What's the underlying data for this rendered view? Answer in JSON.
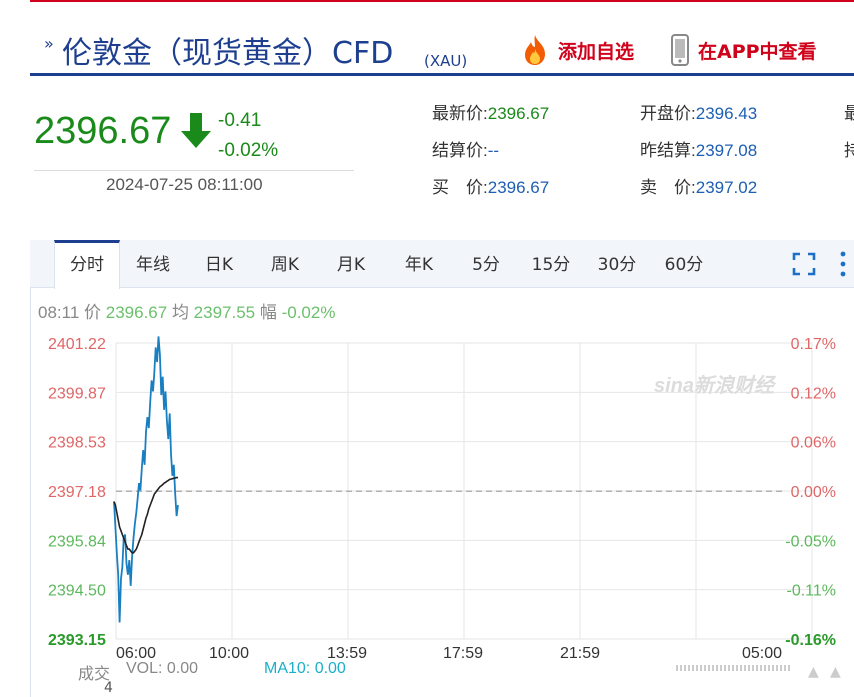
{
  "header": {
    "title": "伦敦金（现货黄金）CFD",
    "code": "(XAU)",
    "add_fav": "添加自选",
    "app_view": "在APP中查看",
    "chevron_glyph": "»"
  },
  "quote": {
    "price": "2396.67",
    "change": "-0.41",
    "change_pct": "-0.02%",
    "datetime": "2024-07-25 08:11:00",
    "direction": "down",
    "color_down": "#1a8a1a"
  },
  "stats": [
    {
      "label": "最新价:",
      "value": "2396.67",
      "green": true
    },
    {
      "label": "开盘价:",
      "value": "2396.43",
      "green": false
    },
    {
      "label": "结算价:",
      "value": "--",
      "green": false
    },
    {
      "label": "昨结算:",
      "value": "2397.08",
      "green": false
    },
    {
      "label": "买　价:",
      "value": "2396.67",
      "green": false
    },
    {
      "label": "卖　价:",
      "value": "2397.02",
      "green": false
    }
  ],
  "stats_cut": [
    "最",
    "持"
  ],
  "tabs": [
    "分时",
    "年线",
    "日K",
    "周K",
    "月K",
    "年K",
    "5分",
    "15分",
    "30分",
    "60分"
  ],
  "active_tab": "分时",
  "info": {
    "time": "08:11",
    "price_label": "价",
    "price": "2396.67",
    "avg_label": "均",
    "avg": "2397.55",
    "range_label": "幅",
    "range": "-0.02%"
  },
  "watermark": "sina新浪财经",
  "volume": {
    "label": "成交",
    "vol": "VOL: 0.00",
    "ma10": "MA10: 0.00",
    "count": "4"
  },
  "chart_data": {
    "type": "line",
    "title": "",
    "y_left_ticks": [
      "2401.22",
      "2399.87",
      "2398.53",
      "2397.18",
      "2395.84",
      "2394.50",
      "2393.15"
    ],
    "y_right_ticks": [
      "0.17%",
      "0.12%",
      "0.06%",
      "0.00%",
      "-0.05%",
      "-0.11%",
      "-0.16%"
    ],
    "x_ticks": [
      "06:00",
      "10:00",
      "13:59",
      "17:59",
      "21:59",
      "05:00"
    ],
    "ylim": [
      2393.15,
      2401.22
    ],
    "reference_price": 2397.18,
    "colors": {
      "price": "#1a7fc1",
      "avg": "#222222",
      "up": "#e06666",
      "down": "#5cb85c",
      "grid": "#e6e6e6"
    },
    "series": [
      {
        "name": "价",
        "values": [
          2396.9,
          2396.2,
          2395.5,
          2394.9,
          2393.6,
          2394.8,
          2395.1,
          2395.9,
          2396.0,
          2395.2,
          2394.9,
          2395.3,
          2394.6,
          2395.4,
          2395.9,
          2396.3,
          2396.6,
          2397.0,
          2397.4,
          2397.2,
          2397.8,
          2398.3,
          2397.9,
          2398.8,
          2399.2,
          2398.9,
          2399.6,
          2400.2,
          2399.9,
          2400.4,
          2401.1,
          2400.7,
          2401.4,
          2400.9,
          2399.8,
          2400.3,
          2399.4,
          2399.9,
          2399.1,
          2398.6,
          2399.3,
          2398.2,
          2397.6,
          2397.9,
          2397.1,
          2396.5,
          2396.8
        ]
      },
      {
        "name": "均",
        "values": [
          2396.9,
          2396.8,
          2396.6,
          2396.4,
          2396.2,
          2396.1,
          2396.0,
          2395.9,
          2395.8,
          2395.7,
          2395.6,
          2395.6,
          2395.55,
          2395.5,
          2395.5,
          2395.55,
          2395.6,
          2395.7,
          2395.8,
          2395.9,
          2396.0,
          2396.15,
          2396.3,
          2396.45,
          2396.55,
          2396.7,
          2396.8,
          2396.9,
          2397.0,
          2397.1,
          2397.15,
          2397.2,
          2397.25,
          2397.3,
          2397.33,
          2397.36,
          2397.4,
          2397.42,
          2397.45,
          2397.47,
          2397.5,
          2397.51,
          2397.52,
          2397.53,
          2397.54,
          2397.55,
          2397.55
        ]
      }
    ]
  }
}
